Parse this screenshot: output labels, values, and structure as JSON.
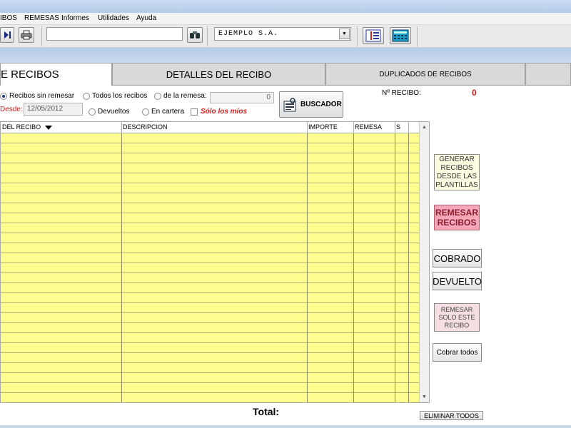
{
  "menu": {
    "items": [
      "IBOS",
      "REMESAS",
      "Informes",
      "Utilidades",
      "Ayuda"
    ]
  },
  "toolbar": {
    "search_value": "",
    "company": "EJEMPLO S.A."
  },
  "tabs": [
    {
      "label": "E RECIBOS"
    },
    {
      "label": "DETALLES DEL RECIBO"
    },
    {
      "label": "DUPLICADOS DE RECIBOS"
    },
    {
      "label": ""
    }
  ],
  "filters": {
    "sin_remesar": "Recibos sin remesar",
    "todos": "Todos los recibos",
    "de_la_remesa": "de la remesa:",
    "remesa_value": "0",
    "desde_label": "Desde:",
    "desde_value": "12/05/2012",
    "devueltos": "Devueltos",
    "en_cartera": "En cartera",
    "solo_mios": "Sólo los míos",
    "selected": "sin_remesar"
  },
  "buscador_label": "BUSCADOR",
  "recibo": {
    "label": "Nº RECIBO:",
    "value": "0"
  },
  "grid": {
    "columns": [
      "DEL RECIBO",
      "DESCRIPCION",
      "IMPORTE",
      "REMESA",
      "S"
    ],
    "rows": []
  },
  "side_buttons": {
    "generar": "GENERAR RECIBOS DESDE LAS PLANTILLAS",
    "remesar": "REMESAR RECIBOS",
    "cobrado": "COBRADO",
    "devuelto": "DEVUELTO",
    "remesar_solo": "REMESAR SOLO ESTE RECIBO",
    "cobrar_todos": "Cobrar todos"
  },
  "footer": {
    "total_label": "Total:",
    "eliminar": "ELIMINAR TODOS"
  },
  "colors": {
    "grid_fill": "#fefe90",
    "remesar_fill": "#f4a7b8",
    "accent_red": "#d02020"
  }
}
